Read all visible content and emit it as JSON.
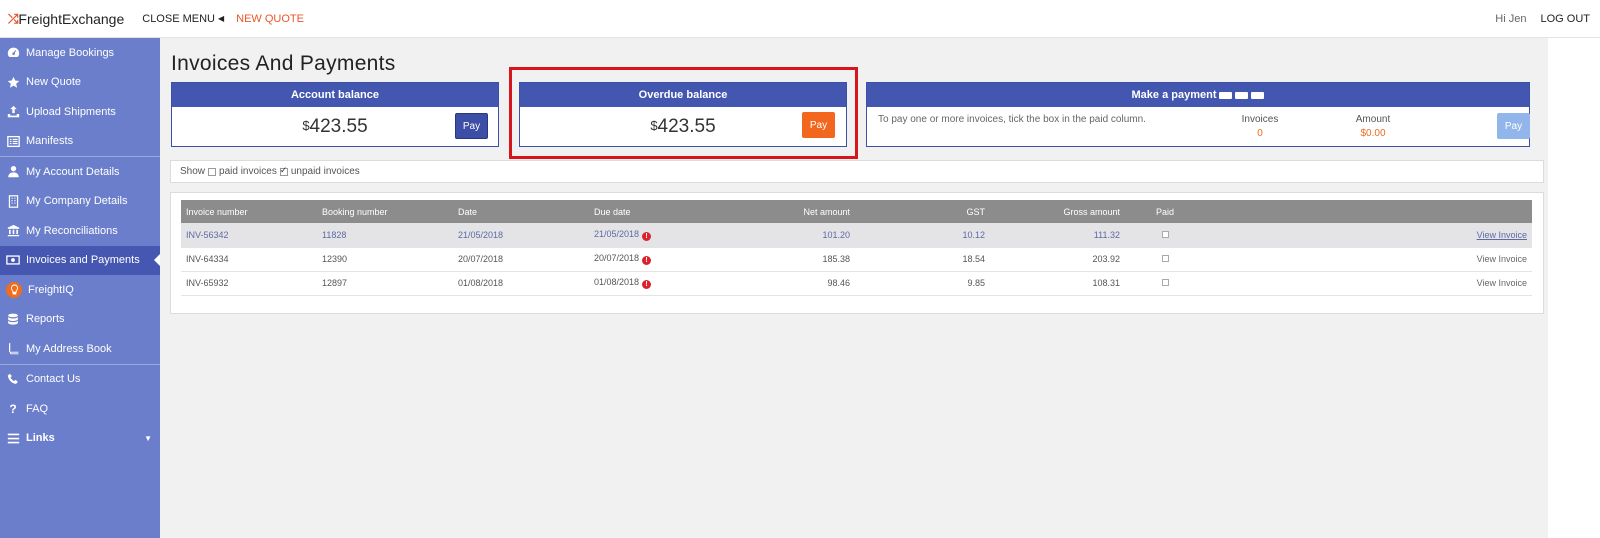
{
  "header": {
    "logo_text": "FreightExchange",
    "close_menu": "CLOSE MENU",
    "new_quote": "NEW QUOTE",
    "greeting": "Hi Jen",
    "logout": "LOG OUT"
  },
  "sidebar": {
    "items": [
      {
        "label": "Manage Bookings",
        "icon": "dashboard-icon"
      },
      {
        "label": "New Quote",
        "icon": "star-icon"
      },
      {
        "label": "Upload Shipments",
        "icon": "upload-icon"
      },
      {
        "label": "Manifests",
        "icon": "list-icon"
      },
      {
        "label": "My Account Details",
        "icon": "user-icon"
      },
      {
        "label": "My Company Details",
        "icon": "building-icon"
      },
      {
        "label": "My Reconciliations",
        "icon": "bank-icon"
      },
      {
        "label": "Invoices and Payments",
        "icon": "money-icon"
      },
      {
        "label": "FreightIQ",
        "icon": "lightbulb-icon"
      },
      {
        "label": "Reports",
        "icon": "database-icon"
      },
      {
        "label": "My Address Book",
        "icon": "book-icon"
      },
      {
        "label": "Contact Us",
        "icon": "phone-icon"
      },
      {
        "label": "FAQ",
        "icon": "question-icon"
      },
      {
        "label": "Links",
        "icon": "menu-icon"
      }
    ]
  },
  "page": {
    "title": "Invoices And Payments"
  },
  "account_balance": {
    "title": "Account balance",
    "currency": "$",
    "amount": "423.55",
    "pay_label": "Pay"
  },
  "overdue_balance": {
    "title": "Overdue balance",
    "currency": "$",
    "amount": "423.55",
    "pay_label": "Pay"
  },
  "make_payment": {
    "title": "Make a payment",
    "instructions": "To pay one or more invoices, tick the box in the paid column.",
    "invoices_label": "Invoices",
    "invoices_value": "0",
    "amount_label": "Amount",
    "amount_value": "$0.00",
    "pay_label": "Pay"
  },
  "filter": {
    "show": "Show",
    "paid": "paid invoices",
    "unpaid": "unpaid invoices",
    "paid_checked": false,
    "unpaid_checked": true
  },
  "table": {
    "headers": [
      "Invoice number",
      "Booking number",
      "Date",
      "Due date",
      "Net amount",
      "GST",
      "Gross amount",
      "Paid",
      ""
    ],
    "rows": [
      {
        "invoice": "INV-56342",
        "booking": "11828",
        "date": "21/05/2018",
        "due": "21/05/2018",
        "net": "101.20",
        "gst": "10.12",
        "gross": "111.32",
        "view": "View Invoice"
      },
      {
        "invoice": "INV-64334",
        "booking": "12390",
        "date": "20/07/2018",
        "due": "20/07/2018",
        "net": "185.38",
        "gst": "18.54",
        "gross": "203.92",
        "view": "View Invoice"
      },
      {
        "invoice": "INV-65932",
        "booking": "12897",
        "date": "01/08/2018",
        "due": "01/08/2018",
        "net": "98.46",
        "gst": "9.85",
        "gross": "108.31",
        "view": "View Invoice"
      }
    ]
  },
  "colors": {
    "sidebar": "#6b7ecb",
    "sidebar_active": "#4657b1",
    "card_header": "#4457b0",
    "accent_orange": "#f3661e",
    "highlight_red": "#d6161c"
  }
}
